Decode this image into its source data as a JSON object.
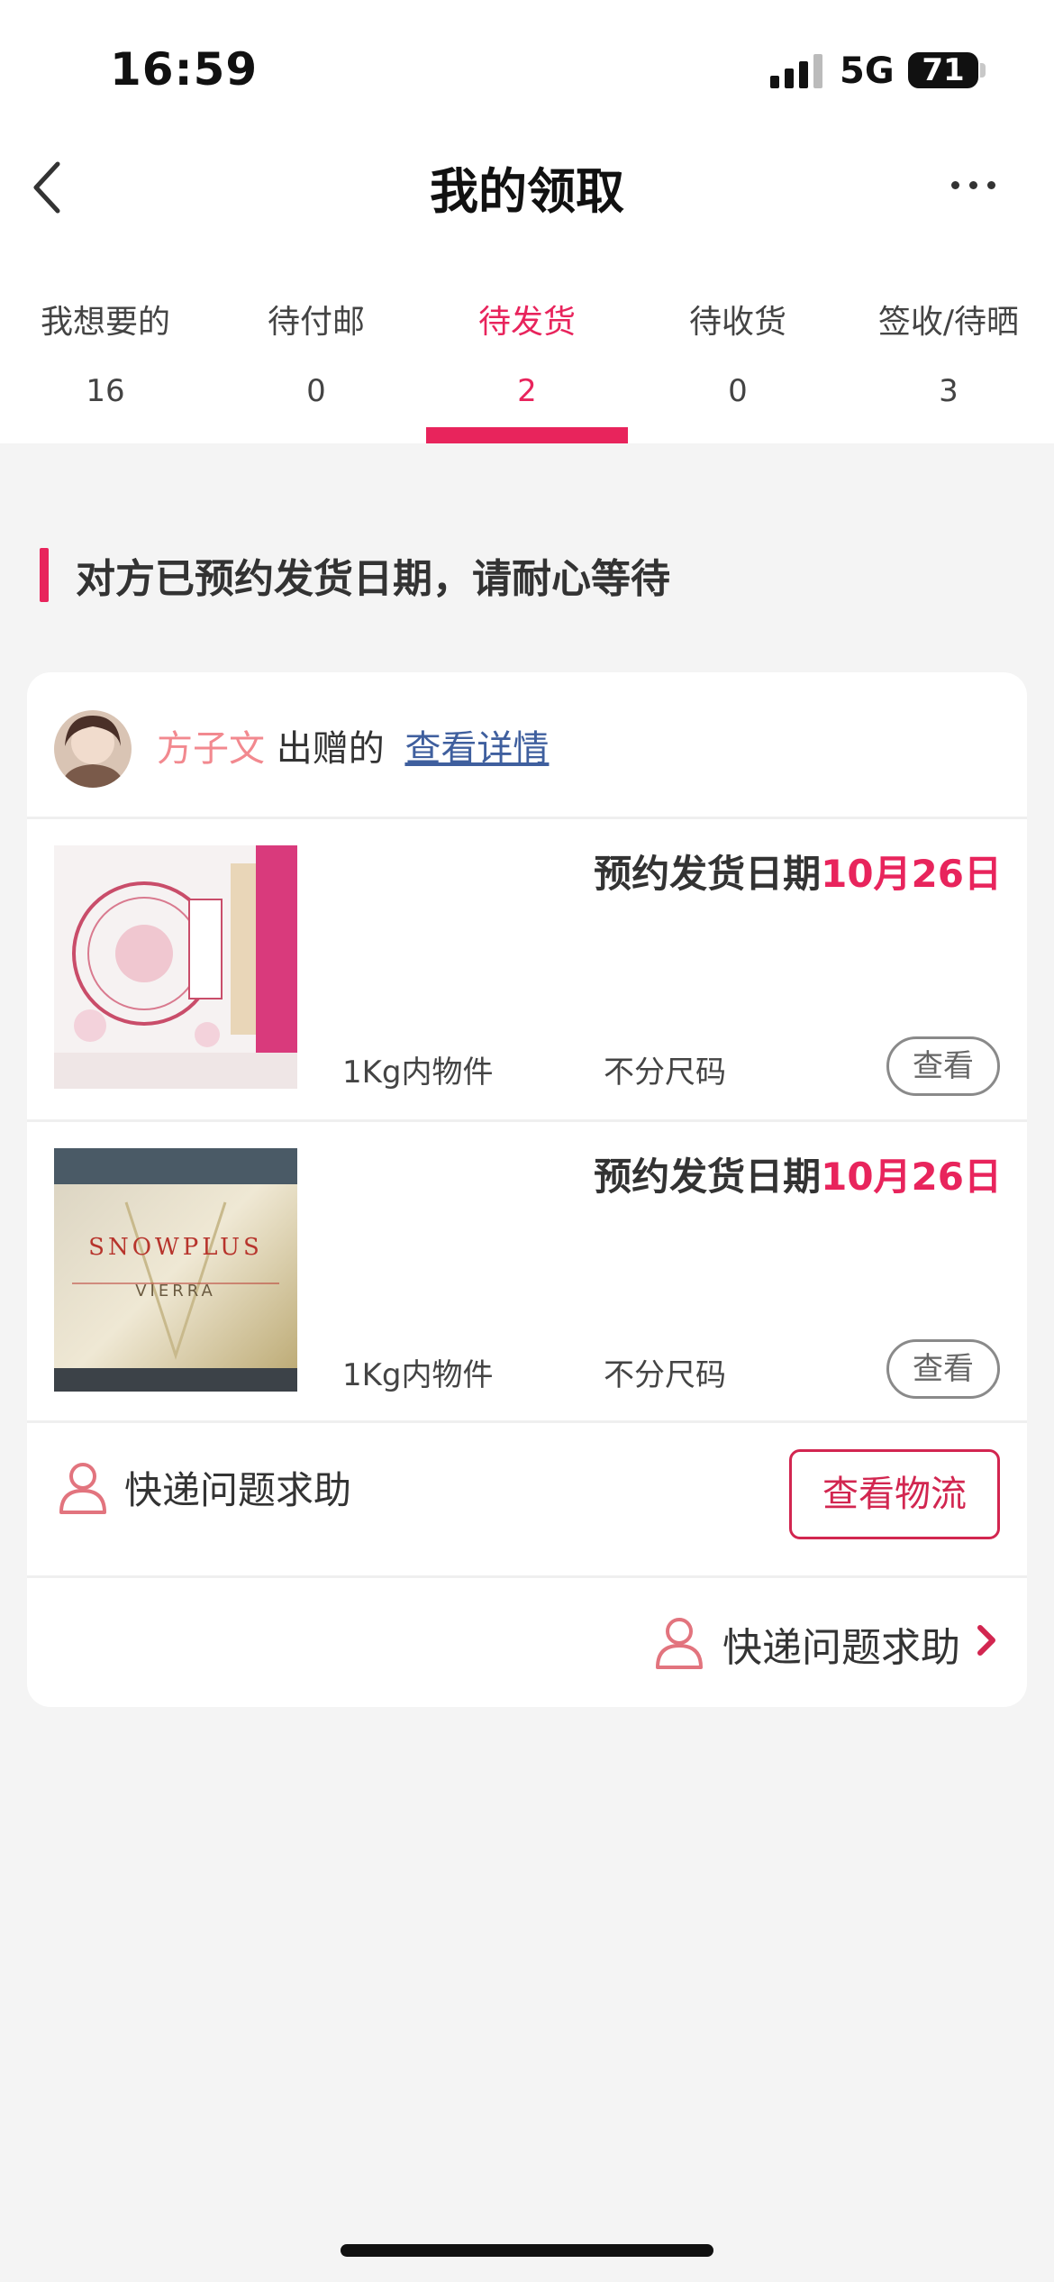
{
  "status_bar": {
    "time": "16:59",
    "network": "5G",
    "battery": "71"
  },
  "nav": {
    "title": "我的领取"
  },
  "tabs": [
    {
      "label": "我想要的",
      "count": "16"
    },
    {
      "label": "待付邮",
      "count": "0"
    },
    {
      "label": "待发货",
      "count": "2",
      "active": true
    },
    {
      "label": "待收货",
      "count": "0"
    },
    {
      "label": "签收/待晒",
      "count": "3"
    }
  ],
  "notice": "对方已预约发货日期，请耐心等待",
  "card": {
    "giver_name": "方子文",
    "giver_suffix": "出赠的",
    "details_link": "查看详情",
    "items": [
      {
        "ship_label": "预约发货日期",
        "ship_date": "10月26日",
        "weight": "1Kg内物件",
        "size": "不分尺码",
        "view_label": "查看",
        "thumb_icon": "product-box-floral-image"
      },
      {
        "ship_label": "预约发货日期",
        "ship_date": "10月26日",
        "weight": "1Kg内物件",
        "size": "不分尺码",
        "view_label": "查看",
        "thumb_icon": "product-box-gold-image",
        "thumb_brand": "SNOWPLUS",
        "thumb_sub": "VIERRA"
      }
    ],
    "help_label": "快递问题求助",
    "logistics_button": "查看物流",
    "help_footer_label": "快递问题求助"
  },
  "colors": {
    "accent": "#e8245c",
    "link": "#3f5f9e",
    "giver_name": "#f2898f",
    "logistics": "#d22650"
  }
}
